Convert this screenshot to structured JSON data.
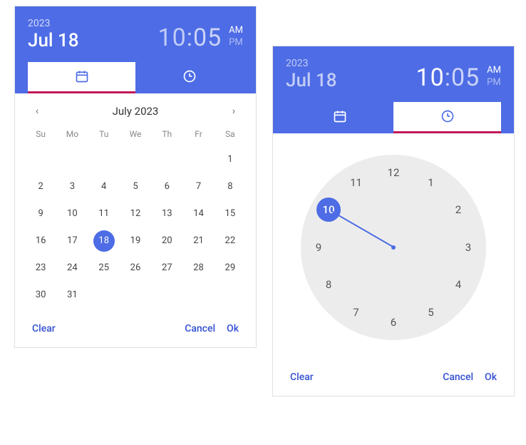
{
  "picker1": {
    "year": "2023",
    "date": "Jul 18",
    "time_h": "10",
    "time_m": "05",
    "am": "AM",
    "pm": "PM",
    "active_tab": "date",
    "month_label": "July 2023",
    "dow": [
      "Su",
      "Mo",
      "Tu",
      "We",
      "Th",
      "Fr",
      "Sa"
    ],
    "weeks": [
      [
        "",
        "",
        "",
        "",
        "",
        "",
        "1"
      ],
      [
        "2",
        "3",
        "4",
        "5",
        "6",
        "7",
        "8"
      ],
      [
        "9",
        "10",
        "11",
        "12",
        "13",
        "14",
        "15"
      ],
      [
        "16",
        "17",
        "18",
        "19",
        "20",
        "21",
        "22"
      ],
      [
        "23",
        "24",
        "25",
        "26",
        "27",
        "28",
        "29"
      ],
      [
        "30",
        "31",
        "",
        "",
        "",
        "",
        ""
      ]
    ],
    "selected_day": "18",
    "clear": "Clear",
    "cancel": "Cancel",
    "ok": "Ok"
  },
  "picker2": {
    "year": "2023",
    "date": "Jul 18",
    "time_h": "10",
    "time_m": "05",
    "am": "AM",
    "pm": "PM",
    "active_tab": "time",
    "hours": [
      "12",
      "1",
      "2",
      "3",
      "4",
      "5",
      "6",
      "7",
      "8",
      "9",
      "10",
      "11"
    ],
    "selected_hour": "10",
    "clear": "Clear",
    "cancel": "Cancel",
    "ok": "Ok"
  }
}
